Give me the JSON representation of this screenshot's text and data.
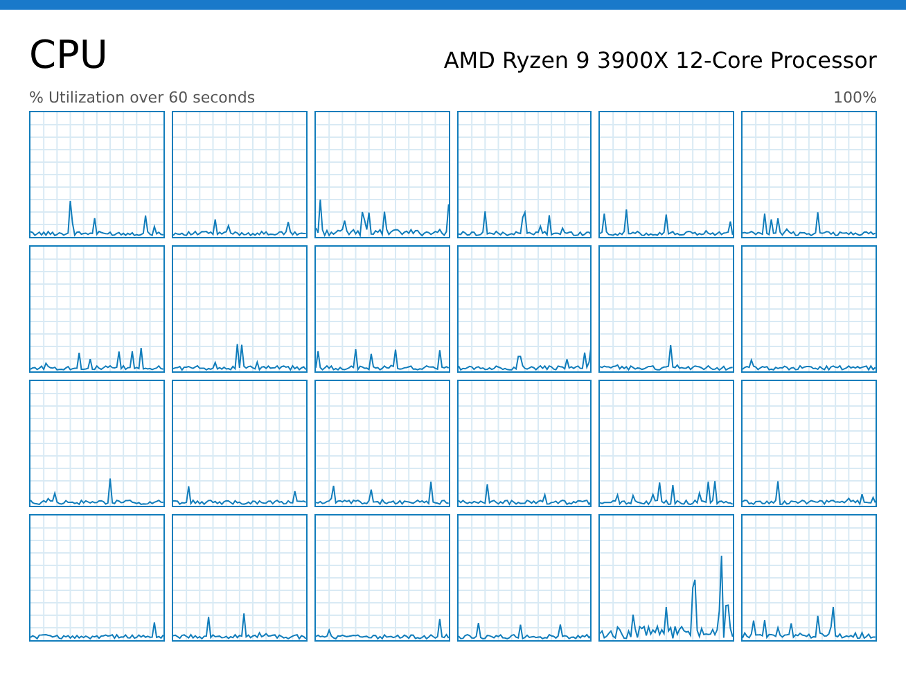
{
  "title": "CPU",
  "processor": "AMD Ryzen 9 3900X 12-Core Processor",
  "axis_label": "% Utilization over 60 seconds",
  "axis_max": "100%"
}
